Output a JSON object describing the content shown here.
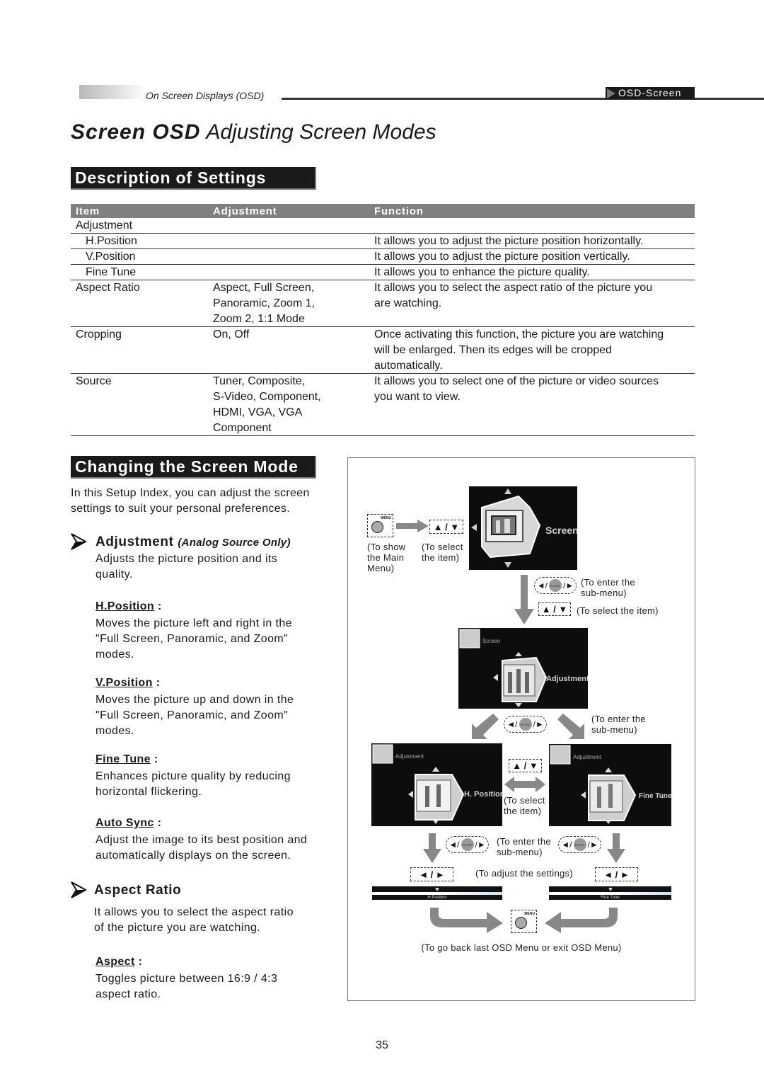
{
  "header": {
    "section_label": "On Screen Displays (OSD)",
    "tab_label": "OSD-Screen"
  },
  "title": {
    "bold": "Screen OSD",
    "light": "Adjusting Screen Modes"
  },
  "description": {
    "heading": "Description of Settings",
    "columns": [
      "Item",
      "Adjustment",
      "Function"
    ],
    "rows": [
      {
        "item": "Adjustment",
        "adjustment": "",
        "function": "",
        "indent": false
      },
      {
        "item": "H.Position",
        "adjustment": "",
        "function": "It allows you to adjust the picture position horizontally.",
        "indent": true
      },
      {
        "item": "V.Position",
        "adjustment": "",
        "function": "It allows you to adjust the picture position vertically.",
        "indent": true
      },
      {
        "item": "Fine Tune",
        "adjustment": "",
        "function": "It allows you to enhance the picture quality.",
        "indent": true
      },
      {
        "item": "Aspect Ratio",
        "adjustment": [
          "Aspect, Full Screen,",
          "Panoramic, Zoom 1,",
          "Zoom 2, 1:1 Mode"
        ],
        "function": [
          "It allows you to select the aspect ratio of the picture you",
          "are watching."
        ],
        "indent": false
      },
      {
        "item": "Cropping",
        "adjustment": [
          "On, Off"
        ],
        "function": [
          "Once activating this function, the picture you are watching",
          "will be enlarged.  Then its edges will be cropped",
          "automatically."
        ],
        "indent": false
      },
      {
        "item": "Source",
        "adjustment": [
          "Tuner, Composite,",
          "S-Video, Component,",
          "HDMI, VGA, VGA",
          "Component"
        ],
        "function": [
          "It allows you to select one of the picture or video sources",
          "you want to view."
        ],
        "indent": false
      }
    ]
  },
  "changing": {
    "heading": "Changing the Screen Mode",
    "intro": [
      "In this Setup Index, you can adjust the screen",
      "settings to suit your personal preferences."
    ],
    "adjustment": {
      "title": "Adjustment",
      "note": "(Analog Source Only)",
      "desc": [
        "Adjusts the picture position and its",
        "quality."
      ],
      "items": [
        {
          "label": "H.Position",
          "sep": " :",
          "desc": [
            "Moves the picture left and right in the",
            "\"Full Screen, Panoramic, and Zoom\"",
            "modes."
          ]
        },
        {
          "label": "V.Position",
          "sep": " :",
          "desc": [
            "Moves the picture up and down in the",
            "\"Full Screen, Panoramic, and Zoom\"",
            "modes."
          ]
        },
        {
          "label": "Fine Tune",
          "sep": " :",
          "desc": [
            "Enhances picture quality by reducing",
            "horizontal flickering."
          ]
        },
        {
          "label": "Auto Sync",
          "sep": " :",
          "desc": [
            "Adjust the image to its best position and",
            "automatically displays on the screen."
          ]
        }
      ]
    },
    "aspect_ratio": {
      "title": "Aspect Ratio",
      "desc": [
        "It allows you to select the aspect ratio",
        "of the picture you are watching."
      ],
      "items": [
        {
          "label": "Aspect",
          "sep": " :",
          "desc": [
            "Toggles picture between 16:9 / 4:3",
            "aspect ratio."
          ]
        }
      ]
    }
  },
  "diagram": {
    "menu_btn_label": "MENU",
    "updown_symbol": "▲ / ▼",
    "leftright_symbol": "◄ / ►",
    "enter_label": "ENTER",
    "cap_show_main": [
      "(To show",
      "the Main",
      "Menu)"
    ],
    "cap_select_item": [
      "(To select",
      "the item)"
    ],
    "cap_enter_sub": [
      "(To enter the",
      "sub-menu)"
    ],
    "cap_select_item_inline": "(To select the item)",
    "cap_adjust": "(To adjust the settings)",
    "cap_go_back": "(To go back last OSD Menu or exit OSD Menu)",
    "screens": {
      "main": {
        "label": "Screen"
      },
      "adjustment": {
        "corner": "Screen",
        "label": "Adjustment"
      },
      "hpos": {
        "corner": "Adjustment",
        "label": "H. Position"
      },
      "finetune": {
        "corner": "Adjustment",
        "label": "Fine Tune"
      }
    },
    "sliders": [
      {
        "label": "H.Position",
        "value_fraction": 0.5
      },
      {
        "label": "Fine Tune",
        "value_fraction": 0.5
      }
    ]
  },
  "page_number": "35"
}
